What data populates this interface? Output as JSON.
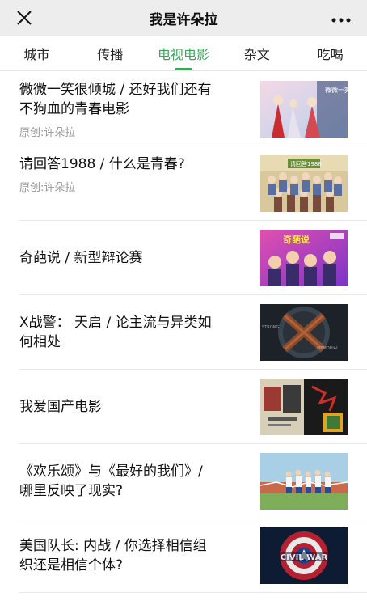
{
  "header": {
    "title": "我是许朵拉",
    "close_icon": "close-icon",
    "more_icon": "more-icon"
  },
  "tabs": [
    {
      "label": "城市",
      "active": false
    },
    {
      "label": "传播",
      "active": false
    },
    {
      "label": "电视电影",
      "active": true
    },
    {
      "label": "杂文",
      "active": false
    },
    {
      "label": "吃喝",
      "active": false
    }
  ],
  "accent_color": "#3fa55a",
  "articles": [
    {
      "line1": "微微一笑很倾城 / 还好我们还有",
      "line2": "不狗血的青春电影",
      "source": "原创:许朵拉",
      "thumb_text": "微微一笑"
    },
    {
      "line1": "请回答1988 / 什么是青春?",
      "line2": "",
      "source": "原创:许朵拉",
      "thumb_text": "请回答1988"
    },
    {
      "line1": "奇葩说 / 新型辩论赛",
      "line2": "",
      "source": "",
      "thumb_text": "奇葩说"
    },
    {
      "line1": "X战警： 天启 / 论主流与异类如",
      "line2": "何相处",
      "source": "",
      "thumb_text": "MEMORIAL"
    },
    {
      "line1": "我爱国产电影",
      "line2": "",
      "source": "",
      "thumb_text": ""
    },
    {
      "line1": "《欢乐颂》与《最好的我们》/",
      "line2": "哪里反映了现实?",
      "source": "",
      "thumb_text": ""
    },
    {
      "line1": "美国队长: 内战 / 你选择相信组",
      "line2": "织还是相信个体?",
      "source": "",
      "thumb_text": "CIVIL WAR"
    }
  ]
}
